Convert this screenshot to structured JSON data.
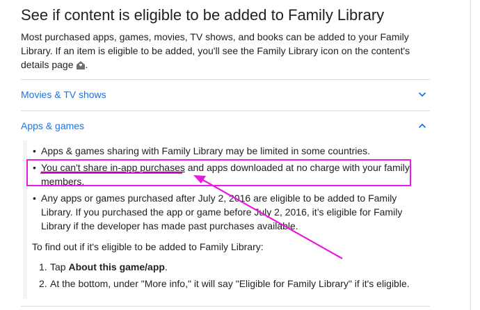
{
  "heading": "See if content is eligible to be added to Family Library",
  "intro": {
    "text": "Most purchased apps, games, movies, TV shows, and books can be added to your Family Library. If an item is eligible to be added, you'll see the Family Library icon on the content's details page",
    "end_punct": ".",
    "icon": "family-library-house-icon"
  },
  "accordions": [
    {
      "title": "Movies & TV shows",
      "state": "collapsed",
      "icon": "chevron-down-icon"
    },
    {
      "title": "Apps & games",
      "state": "expanded",
      "icon": "chevron-up-icon"
    }
  ],
  "apps_games": {
    "bullets": [
      {
        "text": "Apps & games sharing with Family Library may be limited in some countries."
      },
      {
        "link": "You can't share in-app purchases",
        "rest": " and apps downloaded at no charge with your family members."
      },
      {
        "text": "Any apps or games purchased after July 2, 2016 are eligible to be added to Family Library. If you purchased the app or game before July 2, 2016, it’s eligible for Family Library if the developer has made past purchases available."
      }
    ],
    "find_out": "To find out if it's eligible to be added to Family Library:",
    "steps": [
      {
        "num": "1.",
        "prefix": "Tap ",
        "bold": "About this game/app",
        "suffix": "."
      },
      {
        "num": "2.",
        "text": "At the bottom, under \"More info,\" it will say \"Eligible for Family Library\" if it's eligible."
      }
    ]
  },
  "annotation": {
    "color": "#e81be0"
  }
}
